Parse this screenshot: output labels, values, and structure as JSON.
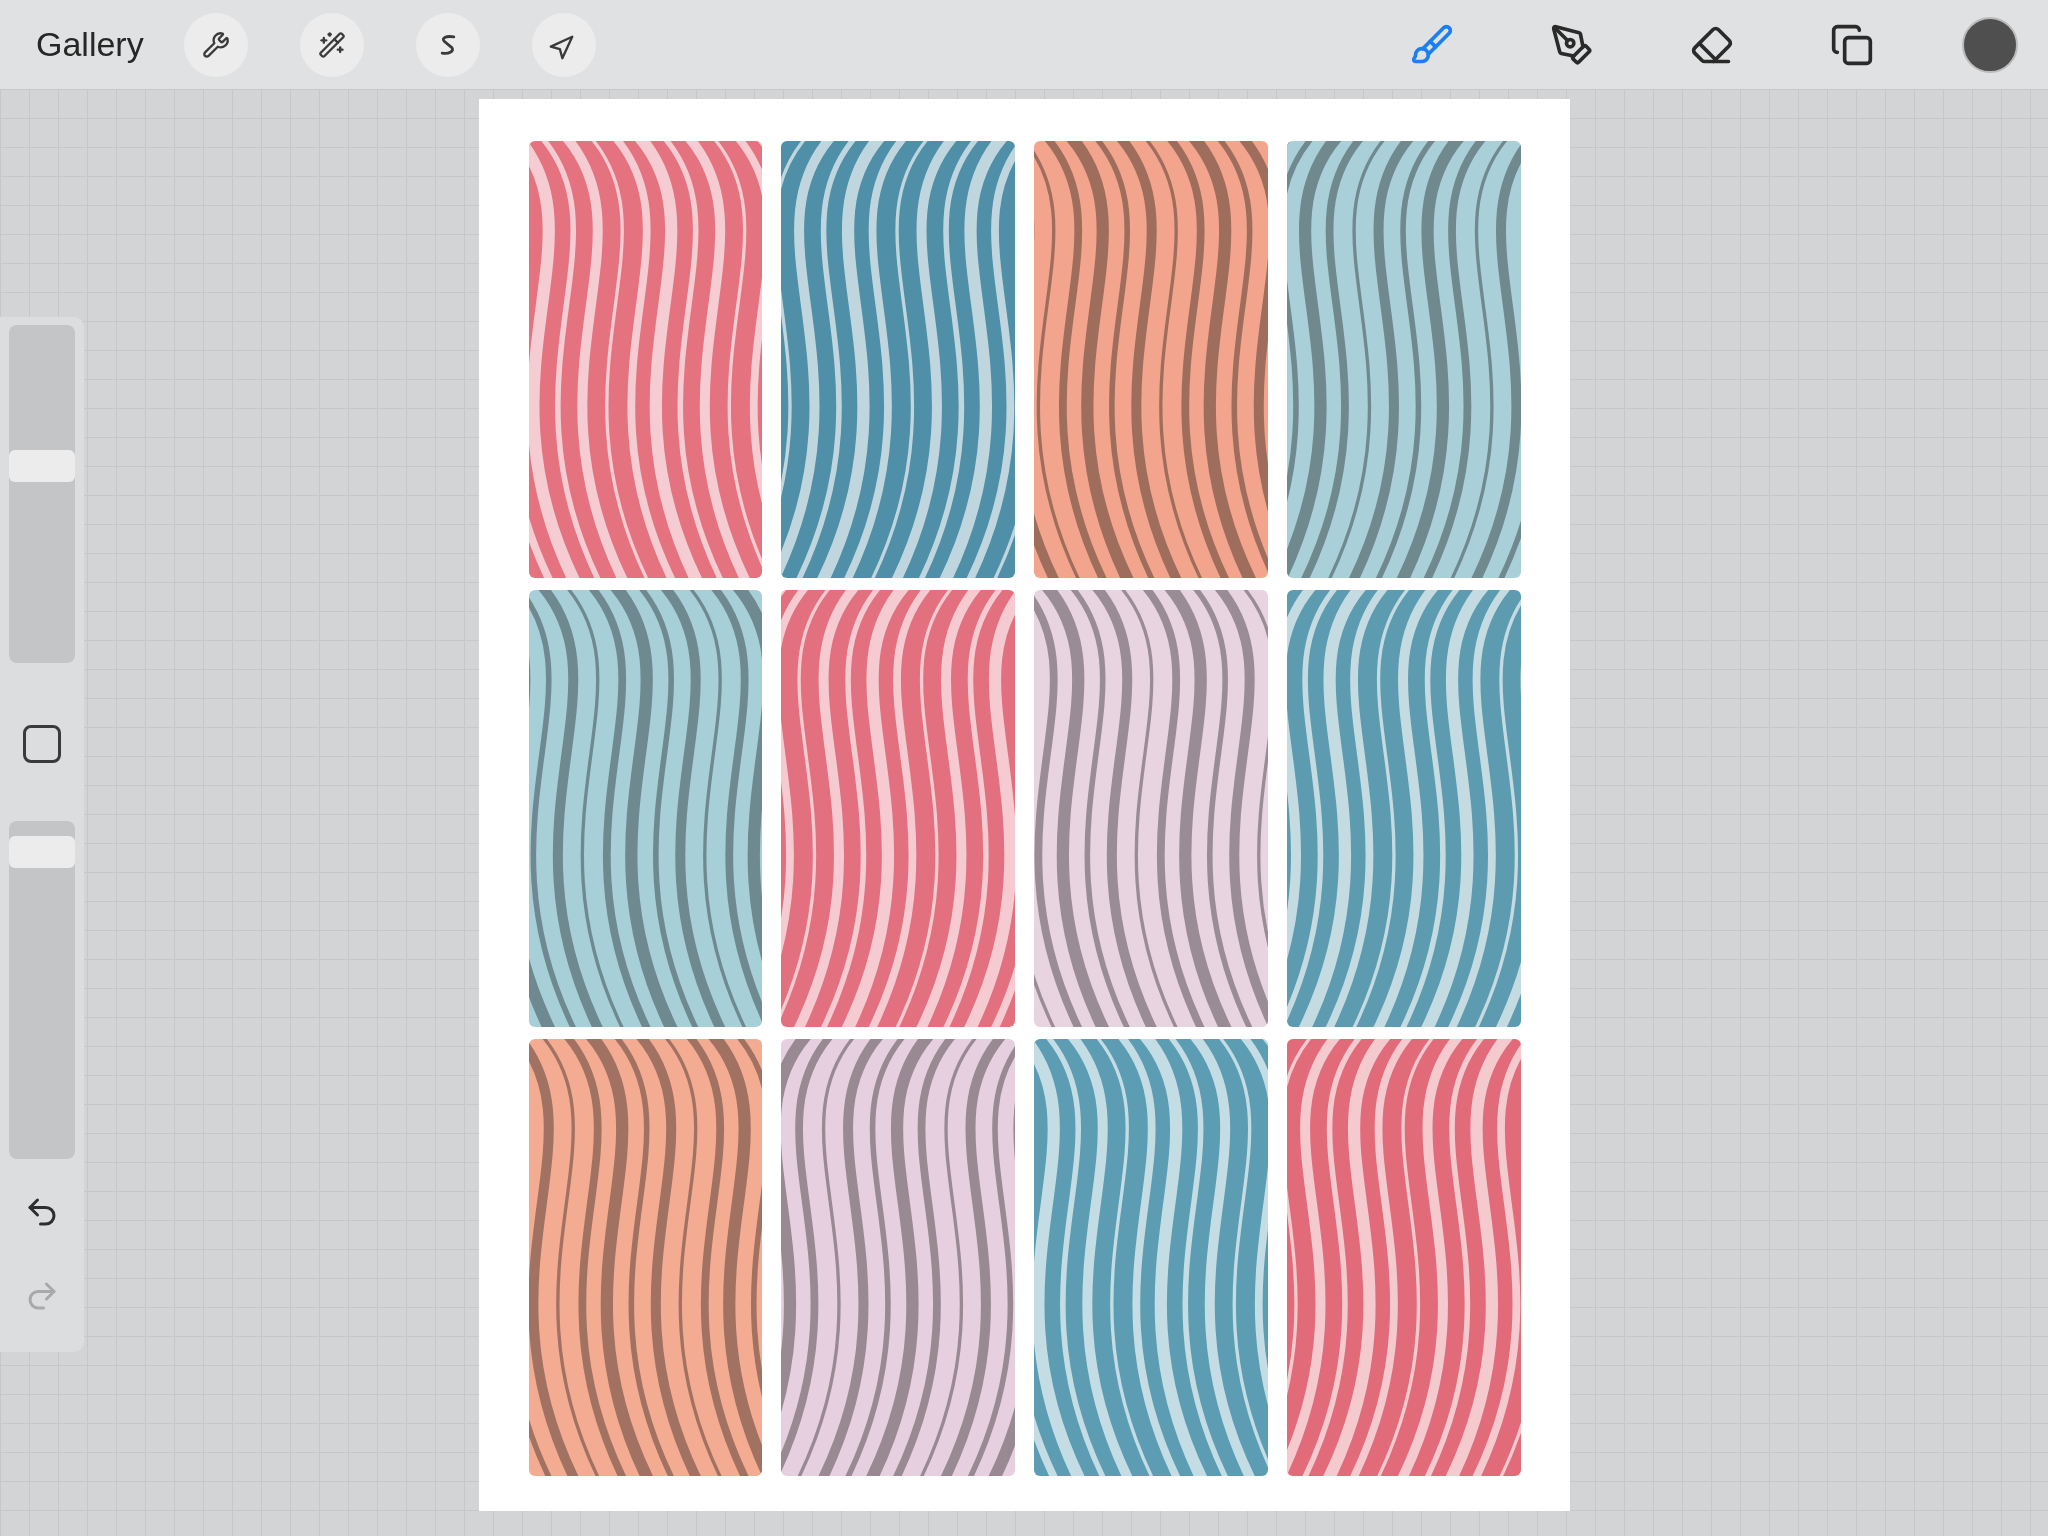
{
  "top_bar": {
    "gallery": "Gallery",
    "left_tools": [
      {
        "kind": "actions",
        "selected": false
      },
      {
        "kind": "adjustments",
        "selected": false
      },
      {
        "kind": "selection",
        "selected": false
      },
      {
        "kind": "transform",
        "selected": false
      }
    ],
    "right_tools": [
      {
        "kind": "brush",
        "selected": true
      },
      {
        "kind": "smudge",
        "selected": false
      },
      {
        "kind": "eraser",
        "selected": false
      },
      {
        "kind": "layers",
        "selected": false
      }
    ],
    "current_color": {
      "color": "#4f4f4f"
    }
  },
  "sidebar": {
    "brush_size": {
      "level": 0.59
    },
    "opacity": {
      "level": 0.95
    },
    "undo": {
      "disabled": false
    },
    "redo": {
      "disabled": true
    }
  },
  "canvas": {
    "tiles": [
      {
        "color": "#e4737f"
      },
      {
        "color": "#4f8fa8"
      },
      {
        "color": "#f2a58c"
      },
      {
        "color": "#a9d0d8"
      },
      {
        "color": "#a7cfd8"
      },
      {
        "color": "#e2707e"
      },
      {
        "color": "#e8d3e0"
      },
      {
        "color": "#5d9cb0"
      },
      {
        "color": "#f3ab92"
      },
      {
        "color": "#e6cfdf"
      },
      {
        "color": "#5c9db3"
      },
      {
        "color": "#e26b7a"
      }
    ]
  }
}
